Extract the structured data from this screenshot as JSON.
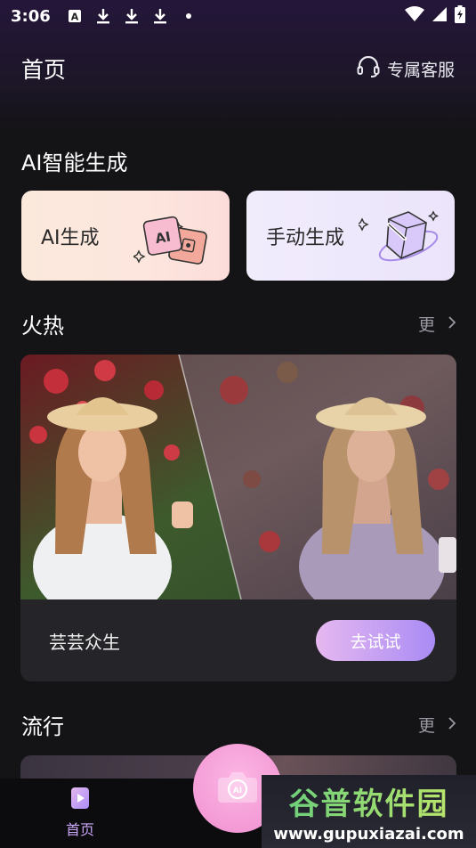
{
  "status_bar": {
    "time": "3:06",
    "icons": [
      "a-text-icon",
      "download-icon",
      "download-icon",
      "download-icon",
      "dot-icon",
      "wifi-icon",
      "signal-icon",
      "battery-icon"
    ]
  },
  "header": {
    "title": "首页",
    "service_label": "专属客服"
  },
  "ai_section": {
    "title": "AI智能生成",
    "cards": [
      {
        "label": "AI生成",
        "icon": "ai-badge-icon"
      },
      {
        "label": "手动生成",
        "icon": "magic-wand-cube-icon"
      }
    ],
    "ai_badge_text": "AI"
  },
  "hot_section": {
    "title": "火热",
    "more_label": "更",
    "card": {
      "name": "芸芸众生",
      "button_label": "去试试"
    }
  },
  "popular_section": {
    "title": "流行",
    "more_label": "更"
  },
  "bottom_nav": {
    "home_label": "首页",
    "camera_badge": "AI"
  },
  "watermark": {
    "title": "谷普软件园",
    "url": "www.gupuxiazai.com"
  },
  "colors": {
    "accent": "#c9a6f7",
    "button_gradient_start": "#e6b8f0",
    "button_gradient_end": "#a98bf4",
    "background": "#141316"
  }
}
